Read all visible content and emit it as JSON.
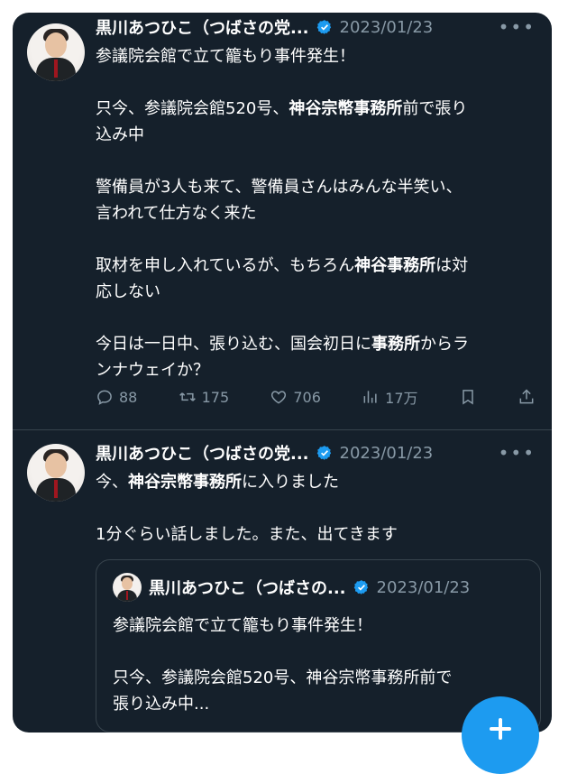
{
  "tweets": [
    {
      "author_name": "黒川あつひこ（つばさの党...",
      "date": "2023/01/23",
      "text_segments": [
        "参議院会館で立て籠もり事件発生！\n\n只今、参議院会館520号、",
        "神谷宗幣事務所",
        "前で張り\n込み中\n\n警備員が3人も来て、警備員さんはみんな半笑い、\n言われて仕方なく来た\n\n取材を申し入れているが、もちろん",
        "神谷事務所",
        "は対\n応しない\n\n今日は一日中、張り込む、国会初日に",
        "事務所",
        "からラ\nンナウェイか？"
      ],
      "stats": {
        "replies": "88",
        "retweets": "175",
        "likes": "706",
        "views": "17万"
      }
    },
    {
      "author_name": "黒川あつひこ（つばさの党...",
      "date": "2023/01/23",
      "text_segments": [
        "今、",
        "神谷宗幣事務所",
        "に入りました\n\n1分ぐらい話しました。また、出てきます"
      ],
      "quote": {
        "author_name": "黒川あつひこ（つばさの...",
        "date": "2023/01/23",
        "text": "参議院会館で立て籠もり事件発生！\n\n只今、参議院会館520号、神谷宗幣事務所前で\n張り込み中..."
      }
    }
  ],
  "icons": {
    "verified": "verified-badge-icon",
    "more": "more-icon",
    "reply": "reply-icon",
    "retweet": "retweet-icon",
    "like": "like-icon",
    "views": "views-icon",
    "bookmark": "bookmark-icon",
    "share": "share-icon",
    "compose": "compose-plus-icon"
  },
  "colors": {
    "background": "#15202b",
    "text": "#ffffff",
    "muted": "#8899a6",
    "border": "#38444d",
    "accent": "#1d9bf0"
  }
}
